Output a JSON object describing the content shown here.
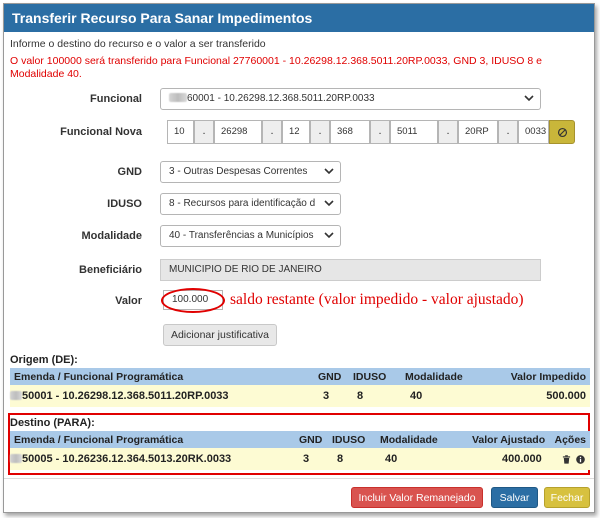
{
  "dialog": {
    "title": "Transferir Recurso Para Sanar Impedimentos",
    "intro": "Informe o destino do recurso e o valor a ser transferido",
    "warning": "O valor 100000 será transferido para Funcional 27760001 - 10.26298.12.368.5011.20RP.0033, GND 3, IDUSO 8 e Modalidade 40."
  },
  "form": {
    "funcional": {
      "label": "Funcional",
      "value": "60001 - 10.26298.12.368.5011.20RP.0033"
    },
    "funcional_nova": {
      "label": "Funcional Nova",
      "segments": [
        "10",
        "26298",
        "12",
        "368",
        "5011",
        "20RP",
        "0033"
      ],
      "separator": "."
    },
    "gnd": {
      "label": "GND",
      "value": "3 - Outras Despesas Correntes"
    },
    "iduso": {
      "label": "IDUSO",
      "value": "8 - Recursos para identificação d"
    },
    "modalidade": {
      "label": "Modalidade",
      "value": "40 - Transferências a Municípios"
    },
    "beneficiario": {
      "label": "Beneficiário",
      "value": "MUNICIPIO DE RIO DE JANEIRO"
    },
    "valor": {
      "label": "Valor",
      "value": "100.000"
    },
    "annotation": "saldo restante (valor impedido - valor ajustado)",
    "justificativa_label": "Adicionar justificativa"
  },
  "origem": {
    "section": "Origem (DE):",
    "headers": {
      "emenda": "Emenda / Funcional Programática",
      "gnd": "GND",
      "iduso": "IDUSO",
      "modalidade": "Modalidade",
      "valor": "Valor Impedido"
    },
    "row": {
      "emenda": "50001 - 10.26298.12.368.5011.20RP.0033",
      "gnd": "3",
      "iduso": "8",
      "modalidade": "40",
      "valor": "500.000"
    }
  },
  "destino": {
    "section": "Destino (PARA):",
    "headers": {
      "emenda": "Emenda / Funcional Programática",
      "gnd": "GND",
      "iduso": "IDUSO",
      "modalidade": "Modalidade",
      "valor": "Valor Ajustado",
      "acoes": "Ações"
    },
    "row": {
      "emenda": "50005 - 10.26236.12.364.5013.20RK.0033",
      "gnd": "3",
      "iduso": "8",
      "modalidade": "40",
      "valor": "400.000"
    },
    "action_icons": [
      "trash-icon",
      "info-icon"
    ]
  },
  "footer": {
    "incluir_label": "Incluir Valor Remanejado",
    "salvar_label": "Salvar",
    "fechar_label": "Fechar"
  },
  "colors": {
    "title_bar": "#2b6ea4",
    "warning_text": "#e00000",
    "table_header": "#a9c9e8",
    "table_row": "#fdfbd3",
    "incluir_button": "#d9534f",
    "salvar_button": "#2b6ea4",
    "fechar_button": "#d7c13f"
  }
}
